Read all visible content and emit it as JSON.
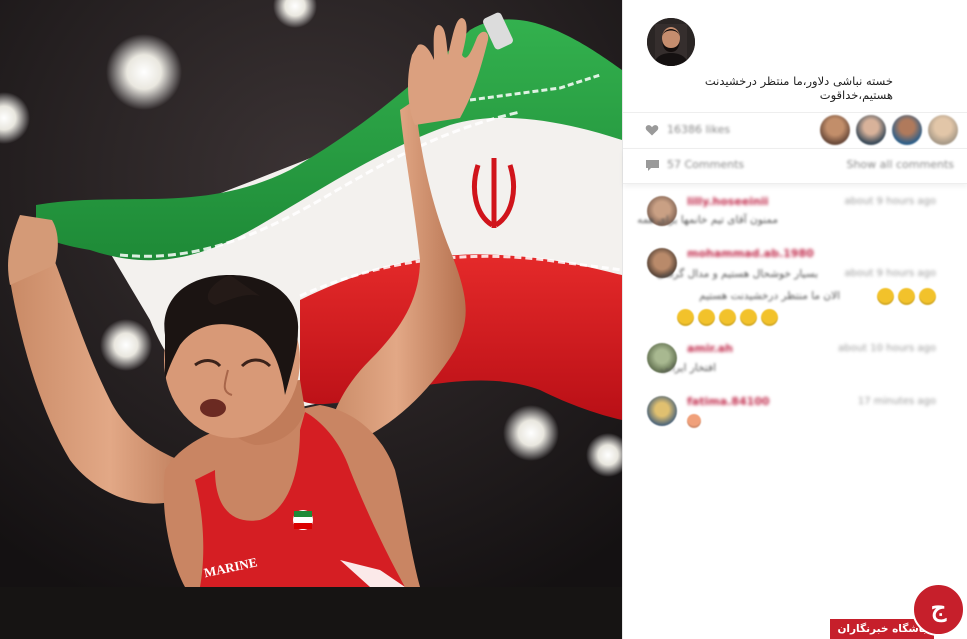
{
  "post": {
    "caption": "خسته نباشی دلاور،ما منتظر درخشیدنت هستیم،خداقوت",
    "likes_text": "16386 likes",
    "comments_count": "57 Comments",
    "show_all_label": "Show all comments"
  },
  "photo": {
    "jersey_text": "MARINE"
  },
  "comments": [
    {
      "user": "lilly.hoseeinii",
      "time": "about 9 hours ago",
      "text": "ممنون آقای تیم خانمها برای همه"
    },
    {
      "user": "mohammad.ab.1980",
      "time": "about 9 hours ago",
      "text": "بسیار خوشحال هستیم و مدال گرفتی",
      "text2": "الان ما منتظر درخشیدنت هستیم",
      "emoji_row1": 3,
      "emoji_row2": 5
    },
    {
      "user": "amir.ah",
      "time": "about 10 hours ago",
      "text": "افتخار ایرانی"
    },
    {
      "user": "fatima.84100",
      "time": "17 minutes ago",
      "text": ""
    }
  ],
  "watermark": {
    "site_name": "باشگاه خبرنگاران",
    "logo_letter": "ج"
  },
  "colors": {
    "flag_green": "#239f40",
    "flag_white": "#ffffff",
    "flag_red": "#da0000",
    "username_red": "#c0294a",
    "brand_red": "#c61f2b"
  }
}
